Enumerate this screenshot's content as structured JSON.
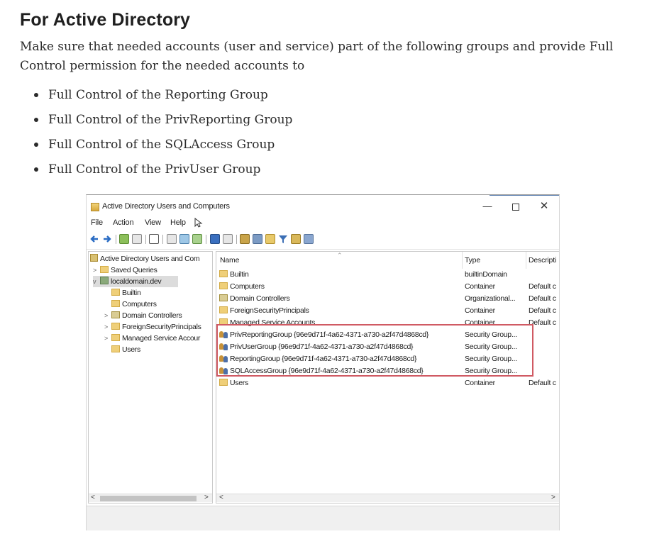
{
  "doc": {
    "title": "For Active Directory",
    "intro": "Make sure that needed accounts (user and service) part of the following groups and provide Full Control permission for the needed accounts to",
    "bullets": [
      "Full Control of the Reporting Group",
      "Full Control of the PrivReporting Group",
      "Full Control of the SQLAccess Group",
      "Full Control of the PrivUser Group"
    ]
  },
  "window": {
    "title": "Active Directory Users and Computers",
    "controls": {
      "minimize": "—",
      "close": "✕"
    },
    "menu": [
      "File",
      "Action",
      "View",
      "Help"
    ],
    "tree": {
      "root": "Active Directory Users and Com",
      "items": [
        {
          "label": "Saved Queries",
          "expander": ">"
        },
        {
          "label": "localdomain.dev",
          "expander": "v"
        },
        {
          "label": "Builtin",
          "expander": ""
        },
        {
          "label": "Computers",
          "expander": ""
        },
        {
          "label": "Domain Controllers",
          "expander": ">"
        },
        {
          "label": "ForeignSecurityPrincipals",
          "expander": ">"
        },
        {
          "label": "Managed Service Accour",
          "expander": ">"
        },
        {
          "label": "Users",
          "expander": ""
        }
      ]
    },
    "list": {
      "columns": {
        "name": "Name",
        "type": "Type",
        "description": "Descripti"
      },
      "rows": [
        {
          "name": "Builtin",
          "type": "builtinDomain",
          "description": ""
        },
        {
          "name": "Computers",
          "type": "Container",
          "description": "Default c"
        },
        {
          "name": "Domain Controllers",
          "type": "Organizational...",
          "description": "Default c"
        },
        {
          "name": "ForeignSecurityPrincipals",
          "type": "Container",
          "description": "Default c"
        },
        {
          "name": "Managed Service Accounts",
          "type": "Container",
          "description": "Default c"
        },
        {
          "name": "PrivReportingGroup {96e9d71f-4a62-4371-a730-a2f47d4868cd}",
          "type": "Security Group...",
          "description": ""
        },
        {
          "name": "PrivUserGroup {96e9d71f-4a62-4371-a730-a2f47d4868cd}",
          "type": "Security Group...",
          "description": ""
        },
        {
          "name": "ReportingGroup {96e9d71f-4a62-4371-a730-a2f47d4868cd}",
          "type": "Security Group...",
          "description": ""
        },
        {
          "name": "SQLAccessGroup {96e9d71f-4a62-4371-a730-a2f47d4868cd}",
          "type": "Security Group...",
          "description": ""
        },
        {
          "name": "Users",
          "type": "Container",
          "description": "Default c"
        }
      ]
    },
    "scroll": {
      "left": "<",
      "right": ">"
    },
    "colors": {
      "highlight": "#d05a63",
      "folder": "#efcf79"
    }
  }
}
